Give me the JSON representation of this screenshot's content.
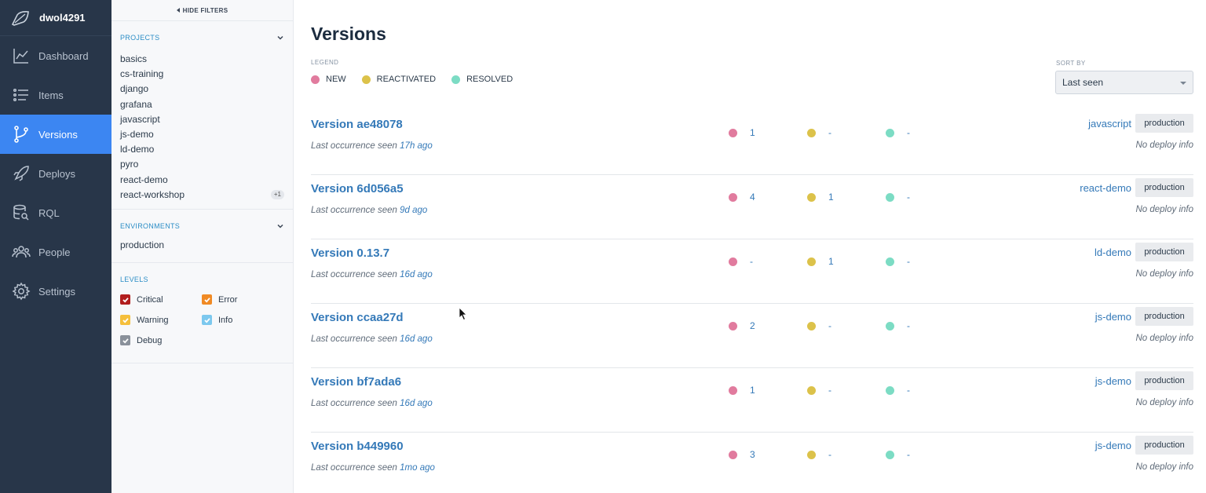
{
  "nav": {
    "user": "dwol4291",
    "items": [
      {
        "label": "Dashboard",
        "icon": "chart-line-icon"
      },
      {
        "label": "Items",
        "icon": "list-icon"
      },
      {
        "label": "Versions",
        "icon": "branch-icon",
        "active": true
      },
      {
        "label": "Deploys",
        "icon": "rocket-icon"
      },
      {
        "label": "RQL",
        "icon": "database-search-icon"
      },
      {
        "label": "People",
        "icon": "people-icon"
      },
      {
        "label": "Settings",
        "icon": "gear-icon"
      }
    ]
  },
  "filters": {
    "hide_label": "HIDE FILTERS",
    "projects": {
      "title": "PROJECTS",
      "items": [
        "basics",
        "cs-training",
        "django",
        "grafana",
        "javascript",
        "js-demo",
        "ld-demo",
        "pyro",
        "react-demo",
        "react-workshop"
      ],
      "more_badge": "+1"
    },
    "environments": {
      "title": "ENVIRONMENTS",
      "items": [
        "production"
      ]
    },
    "levels": {
      "title": "LEVELS",
      "items": [
        {
          "label": "Critical",
          "color": "#b21e1e",
          "checked": true
        },
        {
          "label": "Error",
          "color": "#f08a24",
          "checked": true
        },
        {
          "label": "Warning",
          "color": "#f5bf3c",
          "checked": true
        },
        {
          "label": "Info",
          "color": "#7cc8ee",
          "checked": true
        },
        {
          "label": "Debug",
          "color": "#8a919b",
          "checked": true
        }
      ]
    }
  },
  "main": {
    "title": "Versions",
    "legend_label": "LEGEND",
    "legend": [
      {
        "label": "NEW",
        "color": "#e17b9e"
      },
      {
        "label": "REACTIVATED",
        "color": "#dcc24a"
      },
      {
        "label": "RESOLVED",
        "color": "#7cdcc4"
      }
    ],
    "sort_label": "SORT BY",
    "sort_value": "Last seen",
    "seen_prefix": "Last occurrence seen",
    "versions": [
      {
        "name": "Version ae48078",
        "ago": "17h ago",
        "new": "1",
        "reactivated": "-",
        "resolved": "-",
        "project": "javascript",
        "environment": "production",
        "deploy": "No deploy info"
      },
      {
        "name": "Version 6d056a5",
        "ago": "9d ago",
        "new": "4",
        "reactivated": "1",
        "resolved": "-",
        "project": "react-demo",
        "environment": "production",
        "deploy": "No deploy info"
      },
      {
        "name": "Version 0.13.7",
        "ago": "16d ago",
        "new": "-",
        "reactivated": "1",
        "resolved": "-",
        "project": "ld-demo",
        "environment": "production",
        "deploy": "No deploy info"
      },
      {
        "name": "Version ccaa27d",
        "ago": "16d ago",
        "new": "2",
        "reactivated": "-",
        "resolved": "-",
        "project": "js-demo",
        "environment": "production",
        "deploy": "No deploy info"
      },
      {
        "name": "Version bf7ada6",
        "ago": "16d ago",
        "new": "1",
        "reactivated": "-",
        "resolved": "-",
        "project": "js-demo",
        "environment": "production",
        "deploy": "No deploy info"
      },
      {
        "name": "Version b449960",
        "ago": "1mo ago",
        "new": "3",
        "reactivated": "-",
        "resolved": "-",
        "project": "js-demo",
        "environment": "production",
        "deploy": "No deploy info"
      }
    ]
  }
}
